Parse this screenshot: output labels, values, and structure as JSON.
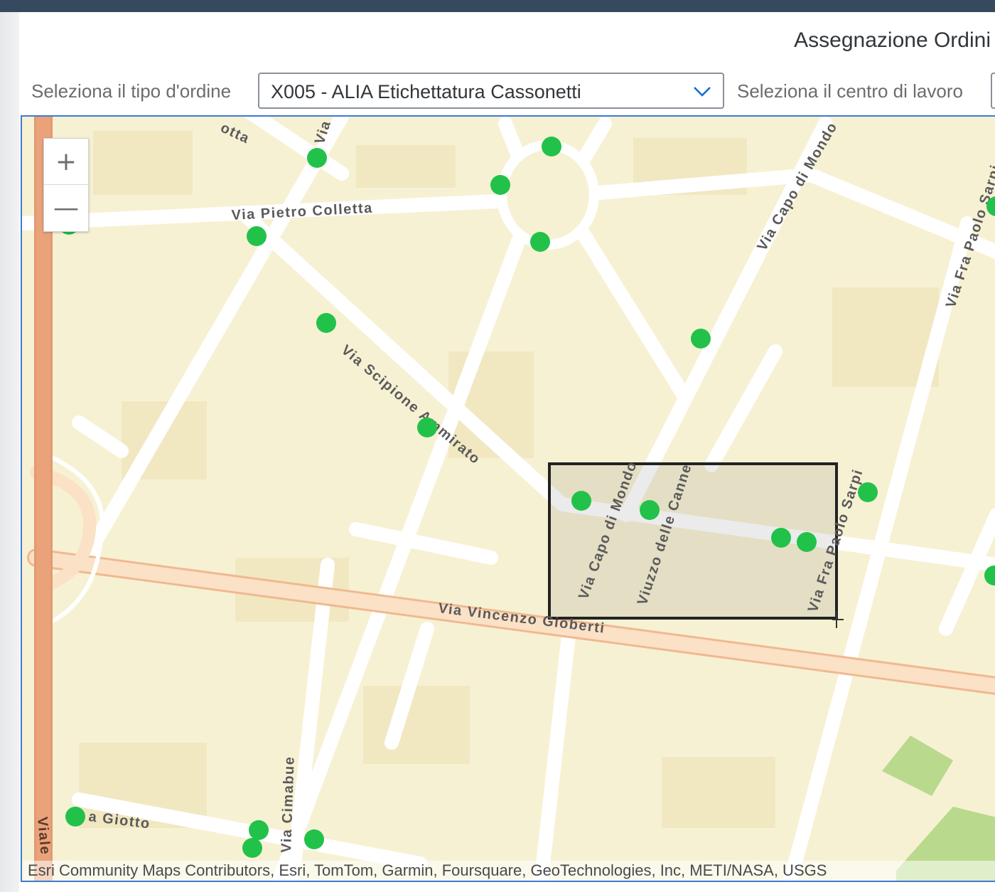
{
  "header": {
    "title": "Assegnazione Ordini"
  },
  "filters": {
    "order_type_label": "Seleziona il tipo d'ordine",
    "order_type_value": "X005 - ALIA Etichettatura Cassonetti",
    "work_center_label": "Seleziona il centro di lavoro"
  },
  "map": {
    "zoom_in": "+",
    "zoom_out": "—",
    "attribution": "Esri Community Maps Contributors, Esri, TomTom, Garmin, Foursquare, GeoTechnologies, Inc, METI/NASA, USGS",
    "marker_color": "#22c24a",
    "selection_box_color": "#222222",
    "street_labels": {
      "via_pietro_colletta": "Via Pietro Colletta",
      "via_scipione_ammirato": "Via Scipione Ammirato",
      "via_vincenzo_gioberti": "Via Vincenzo Gioberti",
      "via_capo_di_mondo_top": "Via Capo di Mondo",
      "via_capo_di_mondo_mid": "Via Capo di Mondo",
      "viuzzo_delle_canne": "Viuzzo delle Canne",
      "via_fra_paolo_sarpi_mid": "Via Fra Paolo Sarpi",
      "via_fra_paolo_sarpi_top": "Via Fra Paolo Sarpi",
      "via_cimabue": "Via Cimabue",
      "via_giotto": "a Giotto",
      "via_top": "Via",
      "botta": "otta",
      "viale": "Viale"
    }
  }
}
